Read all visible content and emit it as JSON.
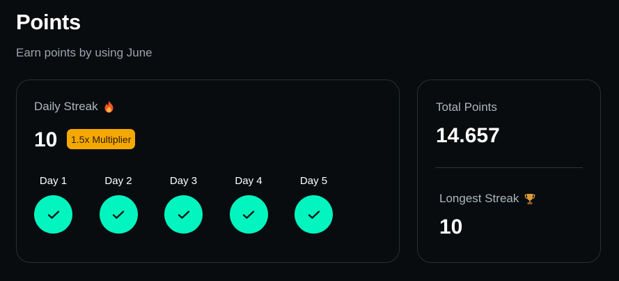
{
  "page": {
    "title": "Points",
    "subtitle": "Earn points by using June"
  },
  "streak_card": {
    "label": "Daily Streak",
    "label_icon": "fire-icon",
    "count": "10",
    "multiplier_badge": "1.5x Multiplier",
    "days": [
      {
        "label": "Day 1",
        "completed": true,
        "icon": "check-icon"
      },
      {
        "label": "Day 2",
        "completed": true,
        "icon": "check-icon"
      },
      {
        "label": "Day 3",
        "completed": true,
        "icon": "check-icon"
      },
      {
        "label": "Day 4",
        "completed": true,
        "icon": "check-icon"
      },
      {
        "label": "Day 5",
        "completed": true,
        "icon": "check-icon"
      }
    ]
  },
  "points_card": {
    "total_label": "Total Points",
    "total_value": "14.657",
    "longest_label": "Longest Streak",
    "longest_icon": "trophy-icon",
    "longest_value": "10"
  },
  "colors": {
    "background": "#080c0f",
    "card_border": "#2a2f33",
    "accent_teal": "#02f5bf",
    "badge_orange": "#f5a800",
    "muted_text": "#aeb6bc"
  }
}
